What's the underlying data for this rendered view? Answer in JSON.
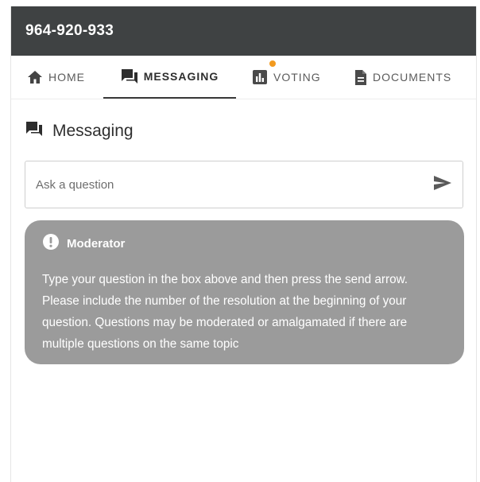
{
  "header": {
    "title": "964-920-933"
  },
  "tabs": [
    {
      "label": "HOME",
      "icon": "home-icon"
    },
    {
      "label": "MESSAGING",
      "icon": "chat-icon",
      "active": true
    },
    {
      "label": "VOTING",
      "icon": "bar-chart-icon",
      "has_notification": true
    },
    {
      "label": "DOCUMENTS",
      "icon": "document-icon"
    }
  ],
  "section": {
    "title": "Messaging",
    "icon": "chat-icon"
  },
  "ask": {
    "placeholder": "Ask a question",
    "value": "",
    "send_icon": "send-icon"
  },
  "moderator": {
    "name": "Moderator",
    "icon": "alert-icon",
    "message": "Type your question in the box above and then press the send arrow. Please include the number of the resolution at the beginning of your question. Questions may be moderated or amalgamated if there are multiple questions on the same topic"
  },
  "colors": {
    "header_bg": "#3f4243",
    "notification_dot": "#f29a1f",
    "moderator_bg": "#9b9b9b"
  }
}
